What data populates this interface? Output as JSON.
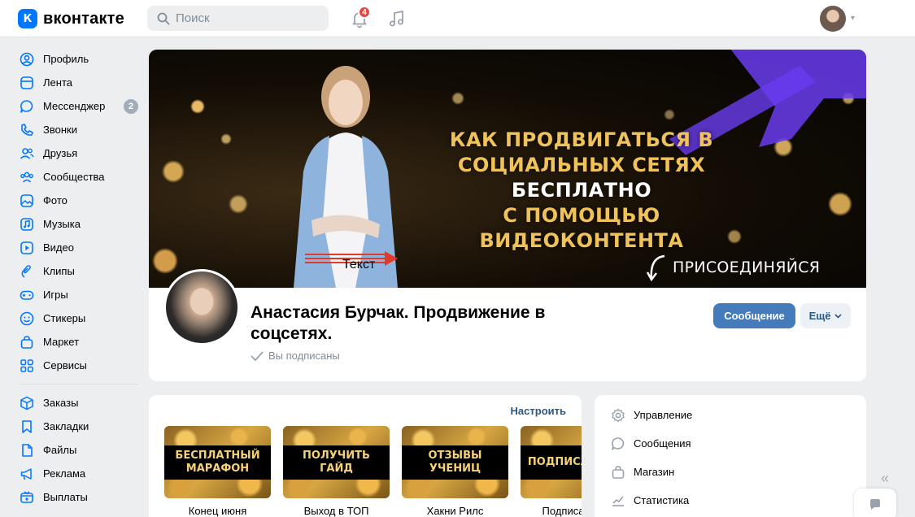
{
  "header": {
    "logo_text": "вконтакте",
    "logo_mark": "К",
    "search_placeholder": "Поиск",
    "notifications_count": "4",
    "brand_color": "#0077ff"
  },
  "sidebar": {
    "items": [
      {
        "label": "Профиль",
        "icon": "user-circle-icon"
      },
      {
        "label": "Лента",
        "icon": "feed-icon"
      },
      {
        "label": "Мессенджер",
        "icon": "chat-bubble-icon",
        "badge": "2"
      },
      {
        "label": "Звонки",
        "icon": "phone-icon"
      },
      {
        "label": "Друзья",
        "icon": "friends-icon"
      },
      {
        "label": "Сообщества",
        "icon": "communities-icon"
      },
      {
        "label": "Фото",
        "icon": "photo-icon"
      },
      {
        "label": "Музыка",
        "icon": "music-icon"
      },
      {
        "label": "Видео",
        "icon": "video-icon"
      },
      {
        "label": "Клипы",
        "icon": "clips-icon"
      },
      {
        "label": "Игры",
        "icon": "gamepad-icon"
      },
      {
        "label": "Стикеры",
        "icon": "smile-icon"
      },
      {
        "label": "Маркет",
        "icon": "shopping-bag-icon"
      },
      {
        "label": "Сервисы",
        "icon": "grid-icon"
      }
    ],
    "items_secondary": [
      {
        "label": "Заказы",
        "icon": "box-icon"
      },
      {
        "label": "Закладки",
        "icon": "bookmark-icon"
      },
      {
        "label": "Файлы",
        "icon": "file-icon"
      },
      {
        "label": "Реклама",
        "icon": "megaphone-icon"
      },
      {
        "label": "Выплаты",
        "icon": "payouts-icon"
      }
    ]
  },
  "cover": {
    "title_line1": "КАК ПРОДВИГАТЬСЯ В",
    "title_line2a": "СОЦИАЛЬНЫХ СЕТЯХ ",
    "title_line2b": "БЕСПЛАТНО",
    "title_line3": "С ПОМОЩЬЮ ВИДЕОКОНТЕНТА",
    "join_label": "ПРИСОЕДИНЯЙСЯ",
    "overlay_text": "Текст",
    "accent_gold": "#f0c35a"
  },
  "profile": {
    "name": "Анастасия Бурчак. Продвижение в соцсетях.",
    "subscribed_label": "Вы подписаны",
    "message_button": "Сообщение",
    "more_button": "Ещё"
  },
  "links_card": {
    "configure_label": "Настроить",
    "tiles": [
      {
        "image_text": "БЕСПЛАТНЫЙ МАРАФОН",
        "label": "Конец июня"
      },
      {
        "image_text": "ПОЛУЧИТЬ ГАЙД",
        "label": "Выход в ТОП"
      },
      {
        "image_text": "ОТЗЫВЫ УЧЕНИЦ",
        "label": "Хакни Рилс"
      },
      {
        "image_text": "ПОДПИСАТЬСЯ",
        "label": "Подписаться"
      }
    ]
  },
  "manage_card": {
    "items": [
      {
        "label": "Управление",
        "icon": "gear-icon"
      },
      {
        "label": "Сообщения",
        "icon": "message-icon"
      },
      {
        "label": "Магазин",
        "icon": "shop-icon"
      },
      {
        "label": "Статистика",
        "icon": "stats-icon"
      }
    ]
  }
}
